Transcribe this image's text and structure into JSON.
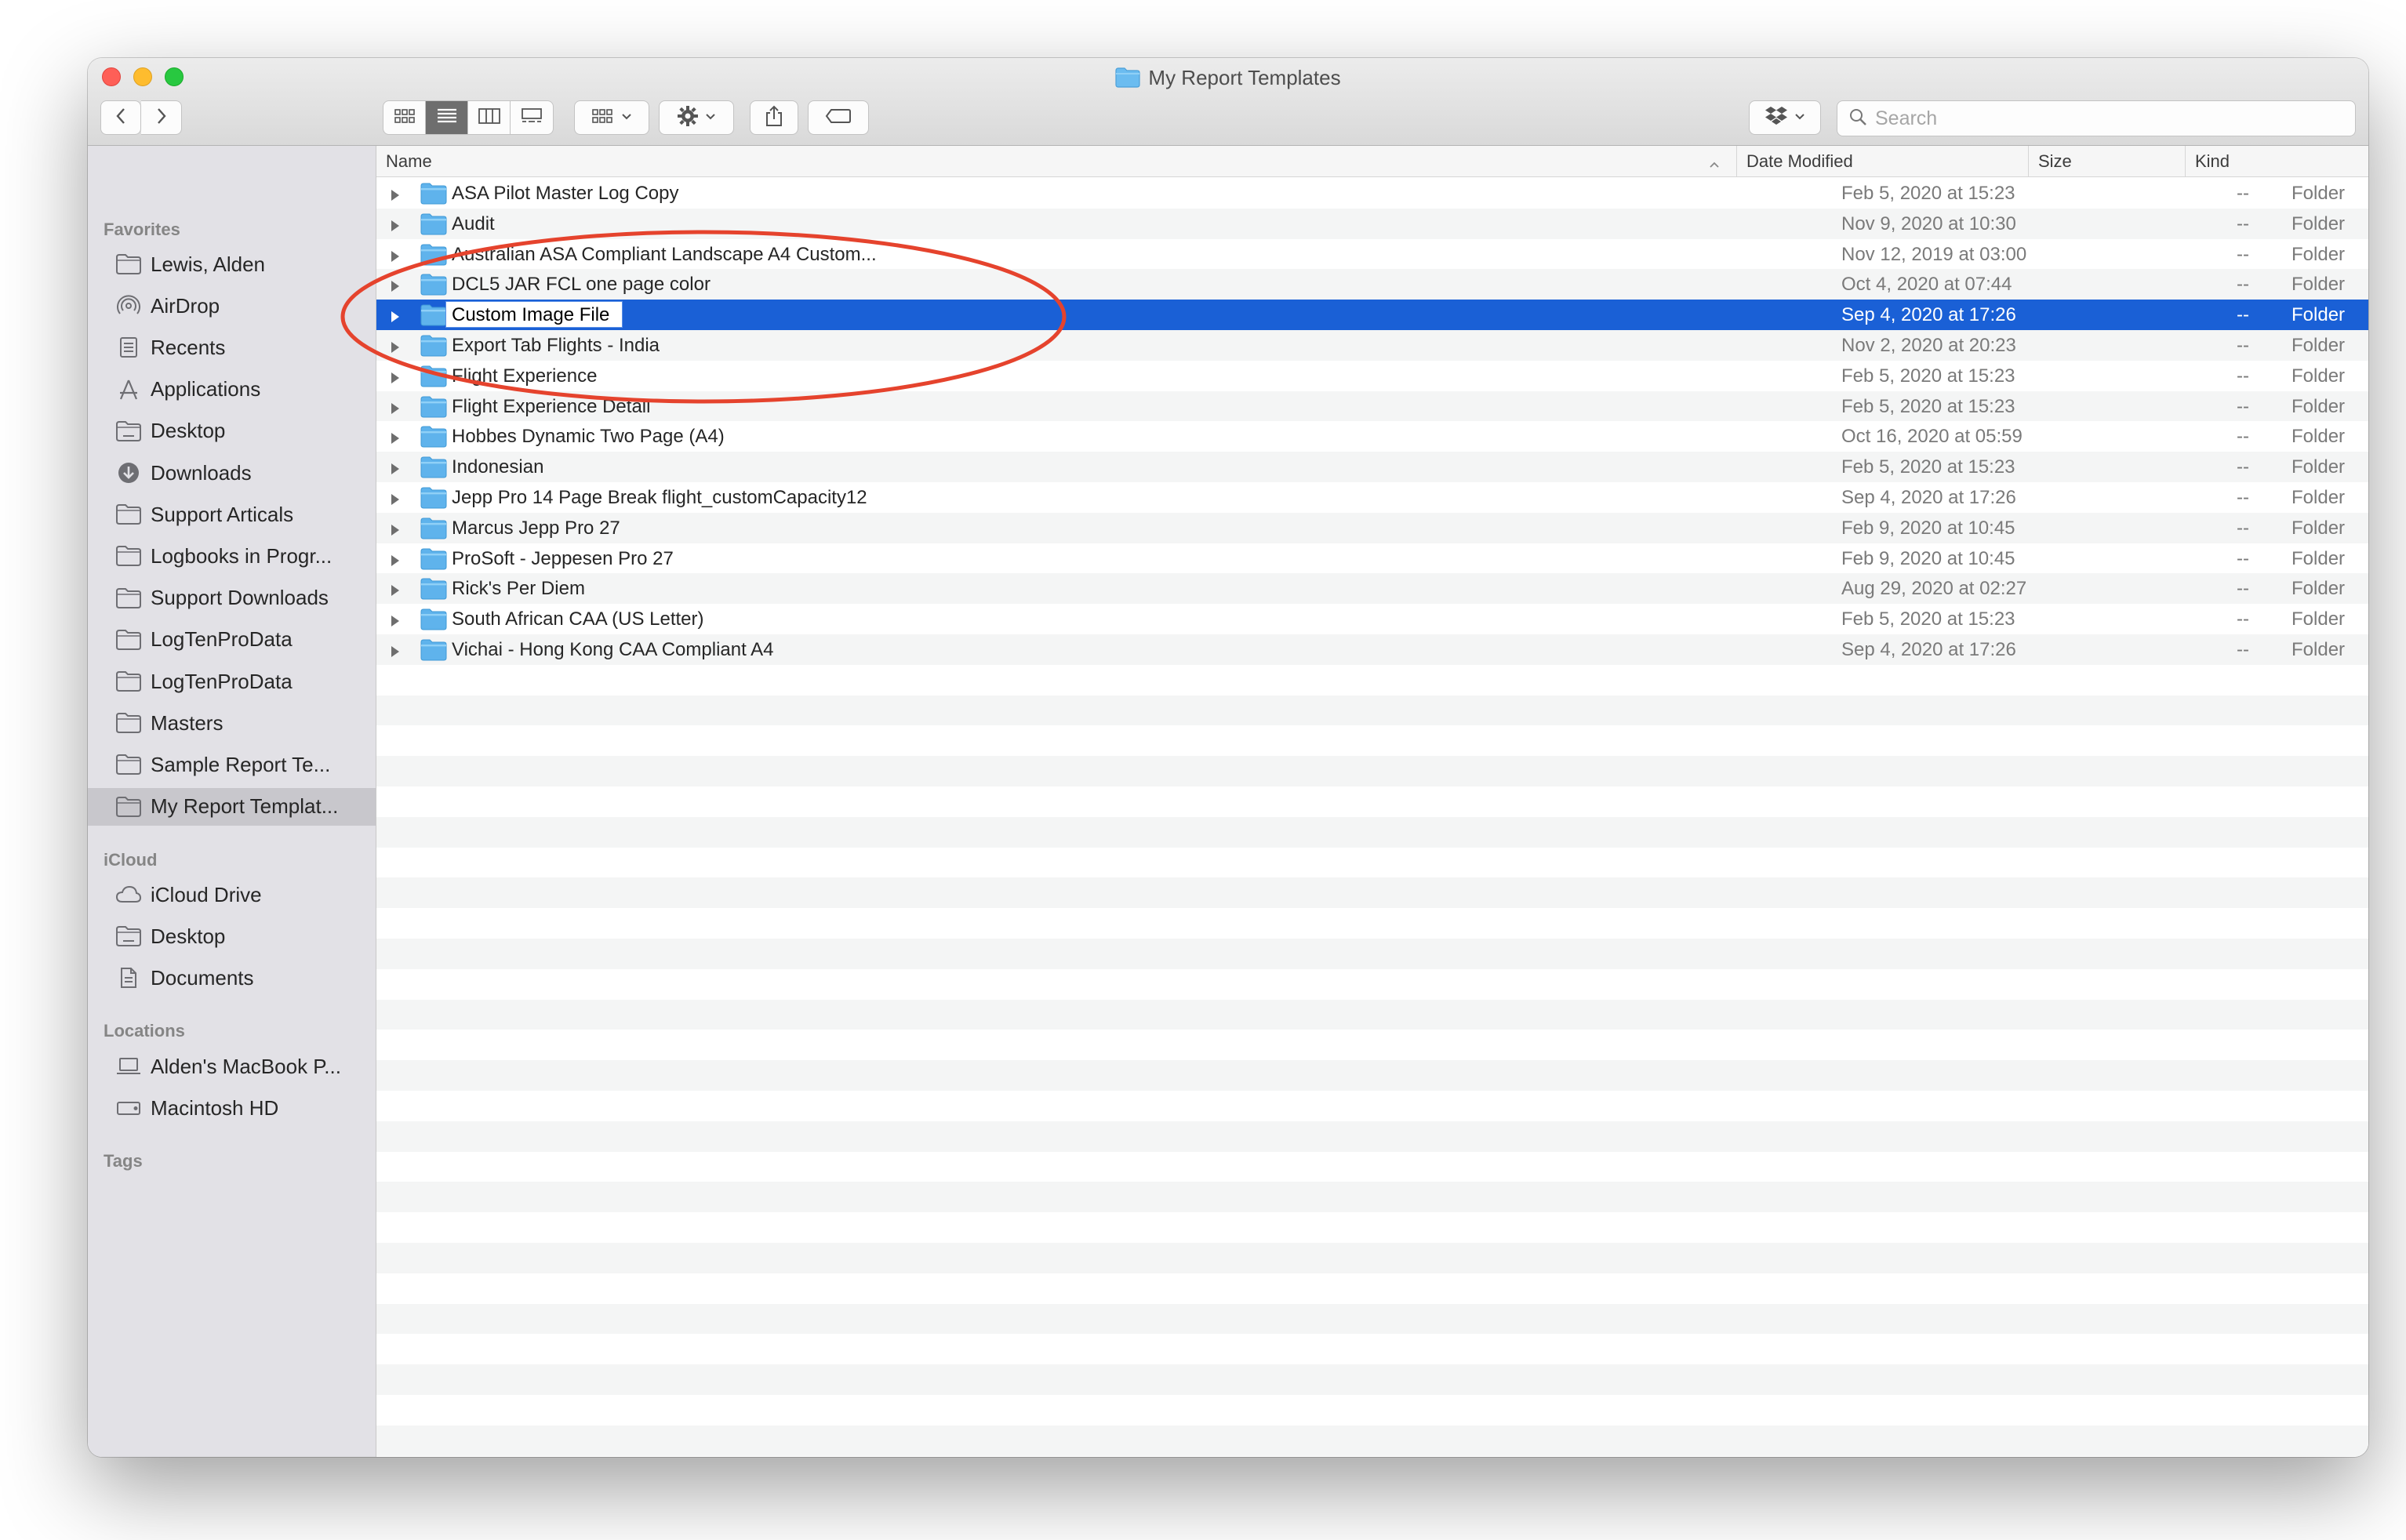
{
  "window": {
    "title": "My Report Templates"
  },
  "toolbar": {
    "back_icon": "chevron-left-icon",
    "forward_icon": "chevron-right-icon",
    "view_modes": [
      "icon-view-icon",
      "list-view-icon",
      "column-view-icon",
      "gallery-view-icon"
    ],
    "selected_view": "list",
    "search_placeholder": "Search"
  },
  "sidebar": {
    "favorites_header": "Favorites",
    "favorites": [
      {
        "label": "Lewis, Alden",
        "icon": "home-folder-icon"
      },
      {
        "label": "AirDrop",
        "icon": "airdrop-icon"
      },
      {
        "label": "Recents",
        "icon": "recents-icon"
      },
      {
        "label": "Applications",
        "icon": "applications-icon"
      },
      {
        "label": "Desktop",
        "icon": "desktop-folder-icon"
      },
      {
        "label": "Downloads",
        "icon": "downloads-icon"
      },
      {
        "label": "Support Articals",
        "icon": "folder-icon"
      },
      {
        "label": "Logbooks in Progr...",
        "icon": "folder-icon"
      },
      {
        "label": "Support Downloads",
        "icon": "folder-icon"
      },
      {
        "label": "LogTenProData",
        "icon": "folder-icon"
      },
      {
        "label": "LogTenProData",
        "icon": "folder-icon"
      },
      {
        "label": "Masters",
        "icon": "folder-icon"
      },
      {
        "label": "Sample Report Te...",
        "icon": "folder-icon"
      },
      {
        "label": "My Report Templat...",
        "icon": "folder-icon",
        "selected": true
      }
    ],
    "icloud_header": "iCloud",
    "icloud": [
      {
        "label": "iCloud Drive",
        "icon": "cloud-icon"
      },
      {
        "label": "Desktop",
        "icon": "desktop-folder-icon"
      },
      {
        "label": "Documents",
        "icon": "documents-icon"
      }
    ],
    "locations_header": "Locations",
    "locations": [
      {
        "label": "Alden's MacBook P...",
        "icon": "laptop-icon"
      },
      {
        "label": "Macintosh HD",
        "icon": "hard-drive-icon"
      }
    ],
    "tags_header": "Tags"
  },
  "columns": {
    "name": "Name",
    "date_modified": "Date Modified",
    "size": "Size",
    "kind": "Kind"
  },
  "files": [
    {
      "name": "ASA Pilot Master Log Copy",
      "date": "Feb 5, 2020 at 15:23",
      "size": "--",
      "kind": "Folder"
    },
    {
      "name": "Audit",
      "date": "Nov 9, 2020 at 10:30",
      "size": "--",
      "kind": "Folder"
    },
    {
      "name": "Australian ASA Compliant Landscape A4 Custom...",
      "date": "Nov 12, 2019 at 03:00",
      "size": "--",
      "kind": "Folder"
    },
    {
      "name": "DCL5 JAR FCL one page color",
      "date": "Oct 4, 2020 at 07:44",
      "size": "--",
      "kind": "Folder"
    },
    {
      "name": "Custom Image File",
      "date": "Sep 4, 2020 at 17:26",
      "size": "--",
      "kind": "Folder",
      "selected": true,
      "editing": true
    },
    {
      "name": "Export Tab Flights - India",
      "date": "Nov 2, 2020 at 20:23",
      "size": "--",
      "kind": "Folder"
    },
    {
      "name": "Flight Experience",
      "date": "Feb 5, 2020 at 15:23",
      "size": "--",
      "kind": "Folder"
    },
    {
      "name": "Flight Experience Detail",
      "date": "Feb 5, 2020 at 15:23",
      "size": "--",
      "kind": "Folder"
    },
    {
      "name": "Hobbes Dynamic Two Page (A4)",
      "date": "Oct 16, 2020 at 05:59",
      "size": "--",
      "kind": "Folder"
    },
    {
      "name": "Indonesian",
      "date": "Feb 5, 2020 at 15:23",
      "size": "--",
      "kind": "Folder"
    },
    {
      "name": "Jepp Pro 14 Page Break  flight_customCapacity12",
      "date": "Sep 4, 2020 at 17:26",
      "size": "--",
      "kind": "Folder"
    },
    {
      "name": "Marcus Jepp Pro 27",
      "date": "Feb 9, 2020 at 10:45",
      "size": "--",
      "kind": "Folder"
    },
    {
      "name": "ProSoft - Jeppesen Pro 27",
      "date": "Feb 9, 2020 at 10:45",
      "size": "--",
      "kind": "Folder"
    },
    {
      "name": "Rick's Per Diem",
      "date": "Aug 29, 2020 at 02:27",
      "size": "--",
      "kind": "Folder"
    },
    {
      "name": "South African CAA (US Letter)",
      "date": "Feb 5, 2020 at 15:23",
      "size": "--",
      "kind": "Folder"
    },
    {
      "name": "Vichai  - Hong Kong CAA Compliant A4",
      "date": "Sep 4, 2020 at 17:26",
      "size": "--",
      "kind": "Folder"
    }
  ],
  "colors": {
    "selection": "#1a60d6",
    "folder": "#5fb3ec",
    "annotation": "#e5432d",
    "sidebar_bg": "#e2e1e6"
  }
}
